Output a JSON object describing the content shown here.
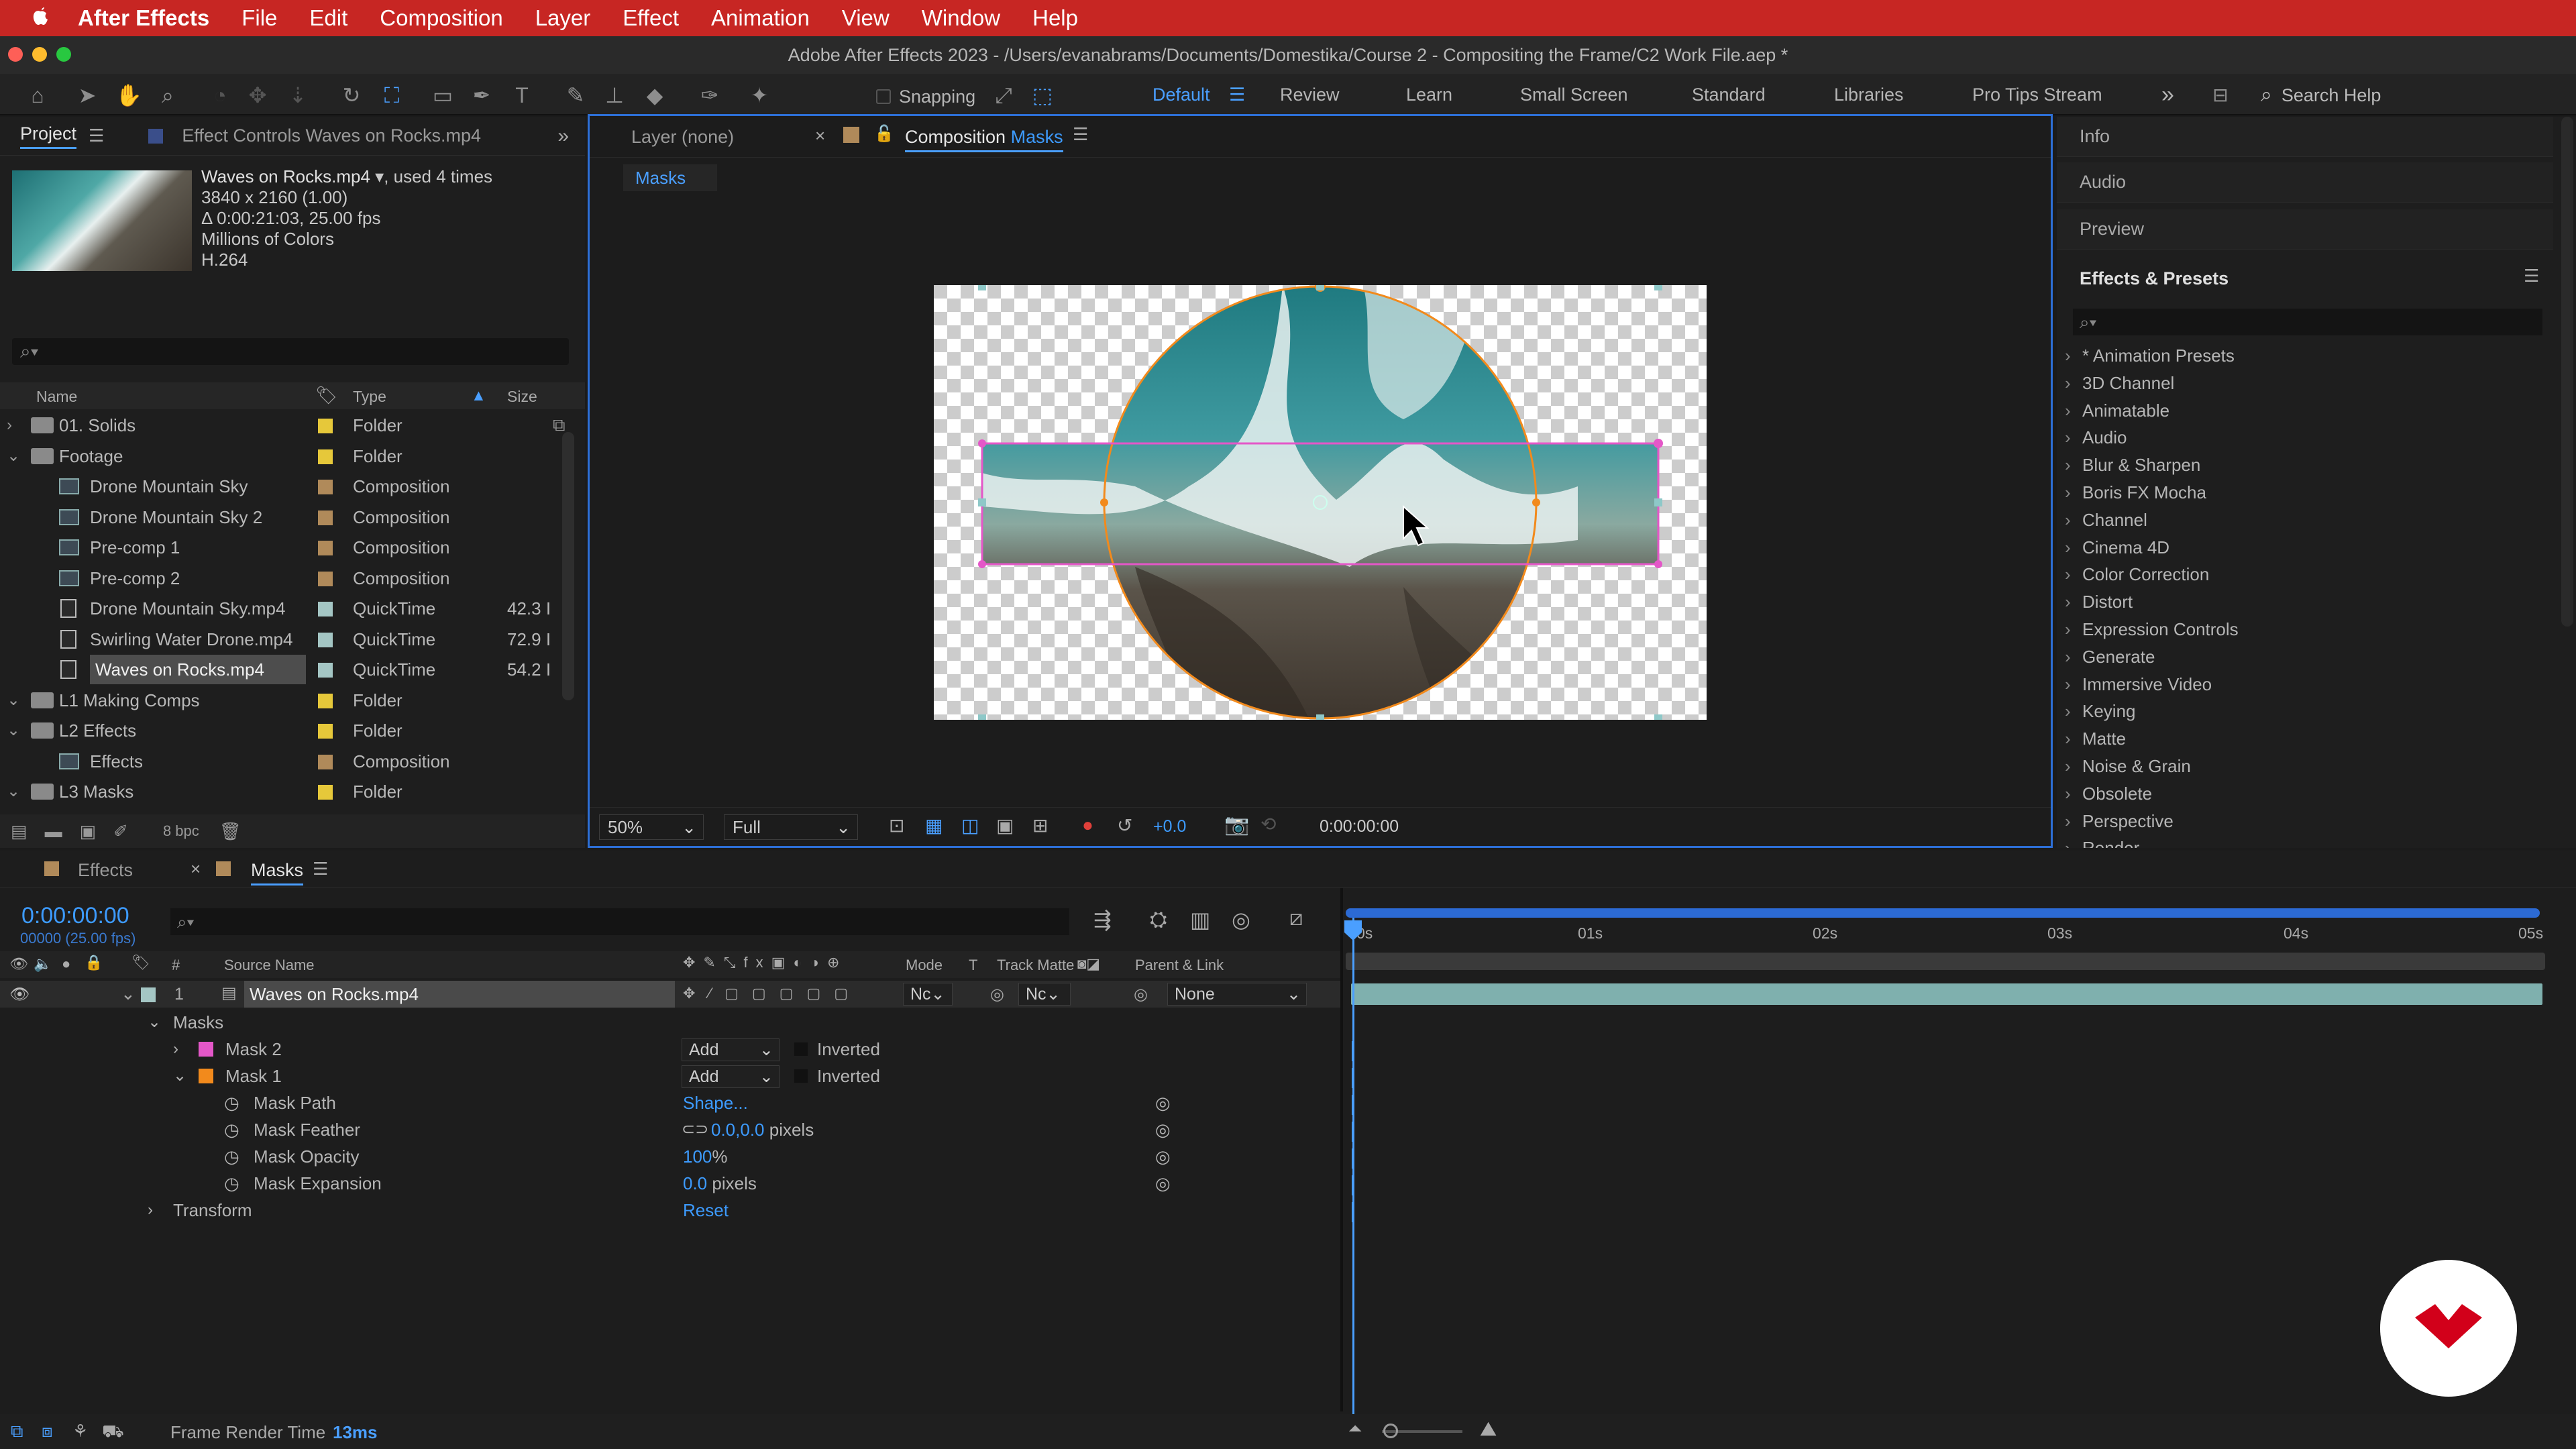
{
  "menubar": {
    "apple": "",
    "app": "After Effects",
    "items": [
      "File",
      "Edit",
      "Composition",
      "Layer",
      "Effect",
      "Animation",
      "View",
      "Window",
      "Help"
    ]
  },
  "window": {
    "title": "Adobe After Effects 2023 - /Users/evanabrams/Documents/Domestika/Course 2 - Compositing the Frame/C2 Work File.aep *"
  },
  "toolbar": {
    "snapping": "Snapping",
    "workspaces": [
      "Default",
      "Review",
      "Learn",
      "Small Screen",
      "Standard",
      "Libraries",
      "Pro Tips Stream"
    ],
    "active_workspace": "Default",
    "search_placeholder": "Search Help",
    "overflow": "»"
  },
  "project": {
    "tab": "Project",
    "effect_controls_tab": "Effect Controls Waves on Rocks.mp4",
    "item_name": "Waves on Rocks.mp4",
    "used": ", used 4 times",
    "resolution": "3840 x 2160 (1.00)",
    "duration": "Δ 0:00:21:03, 25.00 fps",
    "colors": "Millions of Colors",
    "codec": "H.264",
    "columns": {
      "name": "Name",
      "type": "Type",
      "size": "Size"
    },
    "items": [
      {
        "name": "01. Solids",
        "type": "Folder",
        "size": "",
        "indent": 0,
        "kind": "folder",
        "open": false,
        "color": "#e6c83a"
      },
      {
        "name": "Footage",
        "type": "Folder",
        "size": "",
        "indent": 0,
        "kind": "folder",
        "open": true,
        "color": "#e6c83a"
      },
      {
        "name": "Drone Mountain Sky",
        "type": "Composition",
        "size": "",
        "indent": 1,
        "kind": "comp",
        "color": "#b08a5a"
      },
      {
        "name": "Drone Mountain Sky 2",
        "type": "Composition",
        "size": "",
        "indent": 1,
        "kind": "comp",
        "color": "#b08a5a"
      },
      {
        "name": "Pre-comp 1",
        "type": "Composition",
        "size": "",
        "indent": 1,
        "kind": "comp",
        "color": "#b08a5a"
      },
      {
        "name": "Pre-comp 2",
        "type": "Composition",
        "size": "",
        "indent": 1,
        "kind": "comp",
        "color": "#b08a5a"
      },
      {
        "name": "Drone Mountain Sky.mp4",
        "type": "QuickTime",
        "size": "42.3 I",
        "indent": 1,
        "kind": "file",
        "color": "#a4c6c4"
      },
      {
        "name": "Swirling Water Drone.mp4",
        "type": "QuickTime",
        "size": "72.9 I",
        "indent": 1,
        "kind": "file",
        "color": "#a4c6c4"
      },
      {
        "name": "Waves on Rocks.mp4",
        "type": "QuickTime",
        "size": "54.2 I",
        "indent": 1,
        "kind": "file",
        "color": "#a4c6c4",
        "selected": true
      },
      {
        "name": "L1 Making Comps",
        "type": "Folder",
        "size": "",
        "indent": 0,
        "kind": "folder",
        "open": true,
        "color": "#e6c83a"
      },
      {
        "name": "L2 Effects",
        "type": "Folder",
        "size": "",
        "indent": 0,
        "kind": "folder",
        "open": true,
        "color": "#e6c83a"
      },
      {
        "name": "Effects",
        "type": "Composition",
        "size": "",
        "indent": 1,
        "kind": "comp",
        "color": "#b08a5a"
      },
      {
        "name": "L3 Masks",
        "type": "Folder",
        "size": "",
        "indent": 0,
        "kind": "folder",
        "open": true,
        "color": "#e6c83a"
      }
    ],
    "bpc": "8 bpc"
  },
  "viewer": {
    "layer_tab": "Layer (none)",
    "comp_tab_prefix": "Composition",
    "comp_tab_name": "Masks",
    "breadcrumb": "Masks",
    "zoom": "50%",
    "resolution": "Full",
    "exposure": "+0.0",
    "timecode": "0:00:00:00"
  },
  "right_panel": {
    "collapsed": [
      "Info",
      "Audio",
      "Preview"
    ],
    "effects_title": "Effects & Presets",
    "effects": [
      "* Animation Presets",
      "3D Channel",
      "Animatable",
      "Audio",
      "Blur & Sharpen",
      "Boris FX Mocha",
      "Channel",
      "Cinema 4D",
      "Color Correction",
      "Distort",
      "Expression Controls",
      "Generate",
      "Immersive Video",
      "Keying",
      "Matte",
      "Noise & Grain",
      "Obsolete",
      "Perspective",
      "Render"
    ]
  },
  "timeline": {
    "tabs": [
      "Effects",
      "Masks"
    ],
    "active_tab": "Masks",
    "timecode": "0:00:00:00",
    "frames": "00000 (25.00 fps)",
    "columns": {
      "num": "#",
      "source": "Source Name",
      "mode": "Mode",
      "t": "T",
      "trackmatte": "Track Matte",
      "parent": "Parent & Link"
    },
    "layer": {
      "index": "1",
      "name": "Waves on Rocks.mp4",
      "mode": "Nc",
      "matte": "Nc",
      "parent": "None"
    },
    "masks_group": "Masks",
    "mask2": {
      "name": "Mask 2",
      "mode": "Add",
      "inverted": "Inverted",
      "color": "#e457c8"
    },
    "mask1": {
      "name": "Mask 1",
      "mode": "Add",
      "inverted": "Inverted",
      "color": "#f28a1c"
    },
    "props": [
      {
        "name": "Mask Path",
        "value": "Shape...",
        "unit": ""
      },
      {
        "name": "Mask Feather",
        "value": "0.0,0.0",
        "unit": " pixels"
      },
      {
        "name": "Mask Opacity",
        "value": "100",
        "unit": "%"
      },
      {
        "name": "Mask Expansion",
        "value": "0.0",
        "unit": " pixels"
      }
    ],
    "transform": "Transform",
    "reset": "Reset",
    "ruler": [
      "0s",
      "01s",
      "02s",
      "03s",
      "04s",
      "05s"
    ],
    "render_label": "Frame Render Time",
    "render_time": "13ms"
  },
  "colors": {
    "accent": "#3d9bff",
    "menubar": "#c72623",
    "mask_pink": "#e457c8",
    "mask_orange": "#f28a1c",
    "domestika": "#d2001a"
  }
}
